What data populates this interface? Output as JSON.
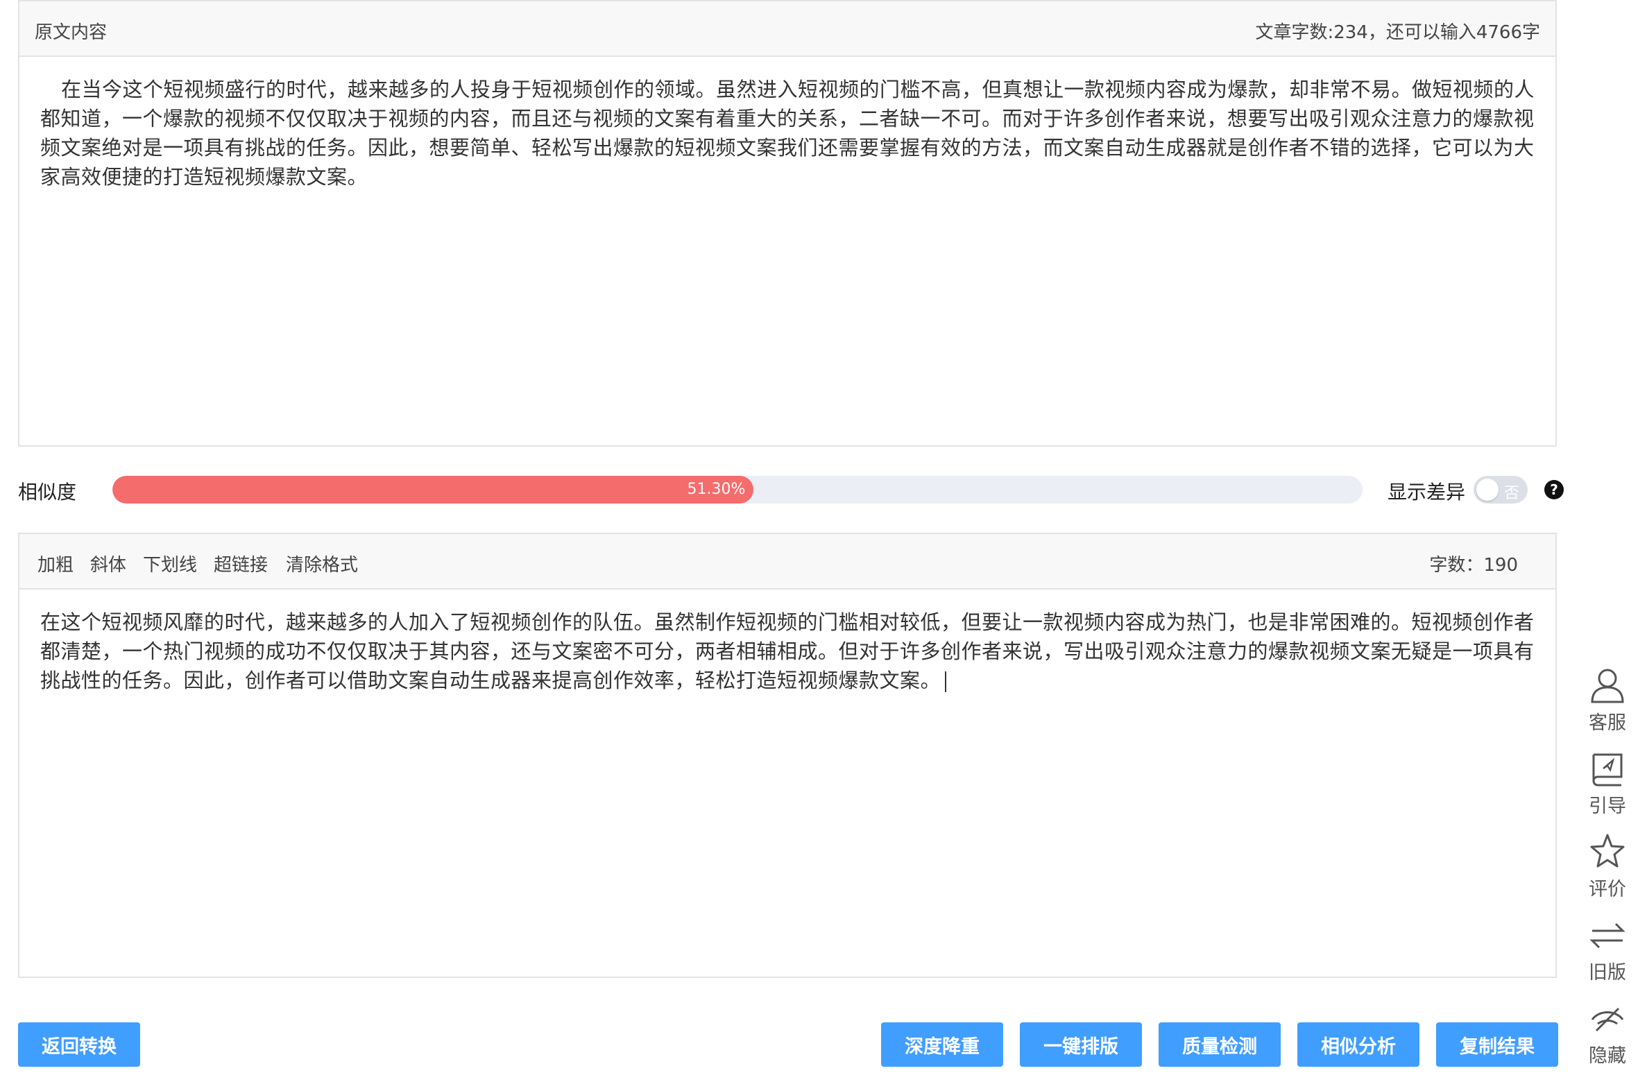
{
  "original": {
    "title": "原文内容",
    "count_text": "文章字数:234，还可以输入4766字",
    "text": "在当今这个短视频盛行的时代，越来越多的人投身于短视频创作的领域。虽然进入短视频的门槛不高，但真想让一款视频内容成为爆款，却非常不易。做短视频的人都知道，一个爆款的视频不仅仅取决于视频的内容，而且还与视频的文案有着重大的关系，二者缺一不可。而对于许多创作者来说，想要写出吸引观众注意力的爆款视频文案绝对是一项具有挑战的任务。因此，想要简单、轻松写出爆款的短视频文案我们还需要掌握有效的方法，而文案自动生成器就是创作者不错的选择，它可以为大家高效便捷的打造短视频爆款文案。"
  },
  "similarity": {
    "label": "相似度",
    "value_text": "51.30%",
    "value": 0.513,
    "fill_color": "#f56c6c",
    "track_color": "#ebeef5"
  },
  "diff": {
    "label": "显示差异",
    "toggle_text": "否",
    "enabled": false,
    "help_icon": "question-circle-icon"
  },
  "toolbar": {
    "bold": "加粗",
    "italic": "斜体",
    "underline": "下划线",
    "link": "超链接",
    "clear": "清除格式",
    "count_text": "字数：190"
  },
  "result": {
    "text": "在这个短视频风靡的时代，越来越多的人加入了短视频创作的队伍。虽然制作短视频的门槛相对较低，但要让一款视频内容成为热门，也是非常困难的。短视频创作者都清楚，一个热门视频的成功不仅仅取决于其内容，还与文案密不可分，两者相辅相成。但对于许多创作者来说，写出吸引观众注意力的爆款视频文案无疑是一项具有挑战性的任务。因此，创作者可以借助文案自动生成器来提高创作效率，轻松打造短视频爆款文案。"
  },
  "buttons": {
    "back": "返回转换",
    "deep": "深度降重",
    "layout": "一键排版",
    "quality": "质量检测",
    "similar": "相似分析",
    "copy": "复制结果",
    "color": "#409eff"
  },
  "sidebar": {
    "service": "客服",
    "guide": "引导",
    "rate": "评价",
    "old": "旧版",
    "hide": "隐藏"
  }
}
